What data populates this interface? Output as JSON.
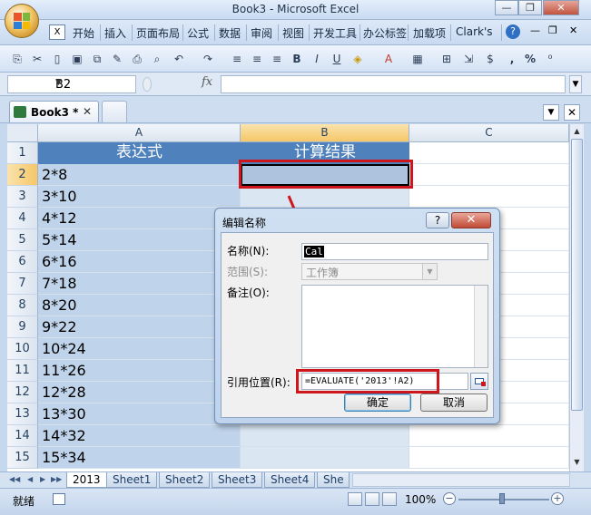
{
  "window": {
    "title": "Book3 - Microsoft Excel",
    "minimize": "—",
    "restore": "❐",
    "close": "✕"
  },
  "ribbon_tabs": [
    "开始",
    "插入",
    "页面布局",
    "公式",
    "数据",
    "审阅",
    "视图",
    "开发工具",
    "办公标签",
    "加载项",
    "Clark's"
  ],
  "ribbon_extras": {
    "help": "?",
    "min": "—",
    "restore": "❐",
    "close": "✕"
  },
  "toolbar_icons": [
    "paste-icon",
    "cut-icon",
    "new-icon",
    "save-icon",
    "copy-icon",
    "format-painter-icon",
    "print-icon",
    "print-preview-icon",
    "undo-icon",
    "redo-icon",
    "align-left-icon",
    "align-center-icon",
    "align-right-icon",
    "bold-icon",
    "italic-icon",
    "underline-icon",
    "fill-color-icon",
    "font-color-icon",
    "borders-icon",
    "merge-icon",
    "wrap-icon",
    "currency-icon",
    "comma-icon",
    "percent-icon",
    "decimal-icon"
  ],
  "toolbar_glyphs": [
    "⎘",
    "✂",
    "▯",
    "▣",
    "⧉",
    "✎",
    "⎙",
    "⌕",
    "↶",
    "↷",
    "≡",
    "≡",
    "≡",
    "B",
    "I",
    "U",
    "◈",
    "A",
    "▦",
    "⊞",
    "⇲",
    "$",
    ",",
    "%",
    "⁰"
  ],
  "formula_bar": {
    "name_box": "B2",
    "fx": "fx",
    "formula": ""
  },
  "workbook_tab": {
    "label": "Book3 *",
    "close": "✕"
  },
  "grid": {
    "columns": [
      "A",
      "B",
      "C"
    ],
    "header_row": {
      "row": "1",
      "a": "表达式",
      "b": "计算结果"
    },
    "rows": [
      {
        "row": "2",
        "a": "2*8"
      },
      {
        "row": "3",
        "a": "3*10"
      },
      {
        "row": "4",
        "a": "4*12"
      },
      {
        "row": "5",
        "a": "5*14"
      },
      {
        "row": "6",
        "a": "6*16"
      },
      {
        "row": "7",
        "a": "7*18"
      },
      {
        "row": "8",
        "a": "8*20"
      },
      {
        "row": "9",
        "a": "9*22"
      },
      {
        "row": "10",
        "a": "10*24"
      },
      {
        "row": "11",
        "a": "11*26"
      },
      {
        "row": "12",
        "a": "12*28"
      },
      {
        "row": "13",
        "a": "13*30"
      },
      {
        "row": "14",
        "a": "14*32"
      },
      {
        "row": "15",
        "a": "15*34"
      }
    ]
  },
  "dialog": {
    "title": "编辑名称",
    "help": "?",
    "close": "✕",
    "name_label": "名称(N):",
    "name_value": "Cal",
    "scope_label": "范围(S):",
    "scope_value": "工作簿",
    "comment_label": "备注(O):",
    "refers_label": "引用位置(R):",
    "refers_value": "=EVALUATE('2013'!A2)",
    "ok": "确定",
    "cancel": "取消"
  },
  "sheet_tabs": [
    "2013",
    "Sheet1",
    "Sheet2",
    "Sheet3",
    "Sheet4",
    "She"
  ],
  "status": {
    "ready": "就绪",
    "zoom": "100%",
    "zoom_minus": "−",
    "zoom_plus": "+"
  },
  "colors": {
    "header_fill": "#4f81bd",
    "selected_col_fill": "#bfd3ea",
    "annotation_red": "#d0161d"
  }
}
